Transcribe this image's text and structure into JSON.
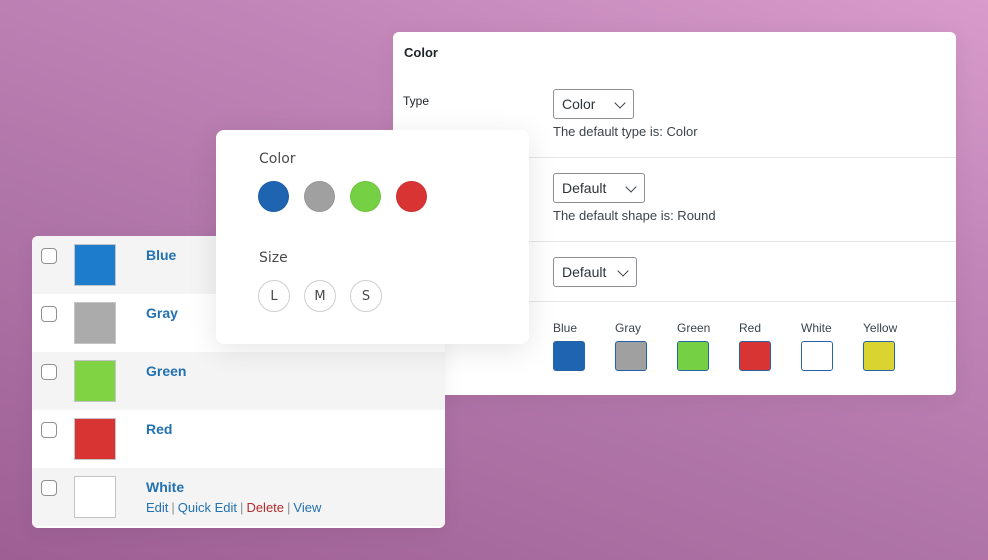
{
  "settings": {
    "title": "Color",
    "type_row": {
      "label": "Type",
      "select_value": "Color",
      "help": "The default type is: Color"
    },
    "shape_row": {
      "select_value": "Default",
      "help": "The default shape is: Round"
    },
    "size_row": {
      "select_value": "Default"
    },
    "swatches": [
      {
        "label": "Blue",
        "color": "#1e64b0"
      },
      {
        "label": "Gray",
        "color": "#a0a0a0"
      },
      {
        "label": "Green",
        "color": "#75d043"
      },
      {
        "label": "Red",
        "color": "#d93434"
      },
      {
        "label": "White",
        "color": "#ffffff"
      },
      {
        "label": "Yellow",
        "color": "#dad431"
      }
    ]
  },
  "card": {
    "color_heading": "Color",
    "colors": [
      {
        "name": "Blue",
        "color": "#1e64b0"
      },
      {
        "name": "Gray",
        "color": "#a0a0a0"
      },
      {
        "name": "Green",
        "color": "#75d043"
      },
      {
        "name": "Red",
        "color": "#d93434"
      }
    ],
    "size_heading": "Size",
    "sizes": [
      "L",
      "M",
      "S"
    ]
  },
  "terms": [
    {
      "name": "Blue",
      "color": "#1e7ccc"
    },
    {
      "name": "Gray",
      "color": "#ababab"
    },
    {
      "name": "Green",
      "color": "#80d444"
    },
    {
      "name": "Red",
      "color": "#d93434"
    },
    {
      "name": "White",
      "color": "#ffffff"
    }
  ],
  "row_actions": {
    "edit": "Edit",
    "quick_edit": "Quick Edit",
    "delete": "Delete",
    "view": "View",
    "separator": "|"
  }
}
